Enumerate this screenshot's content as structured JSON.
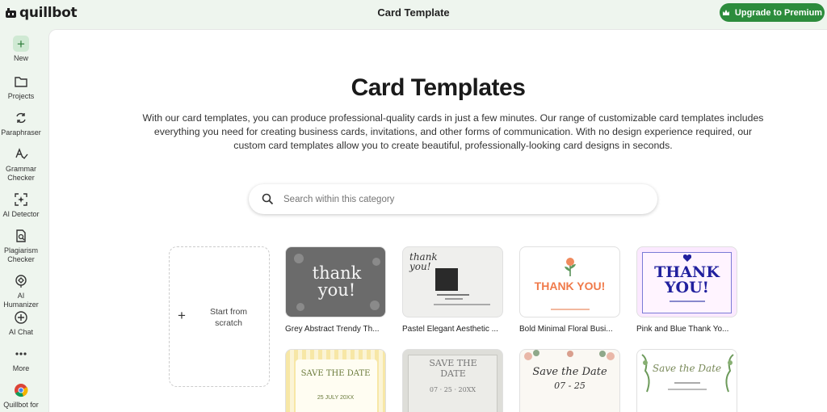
{
  "app": {
    "logo_text": "quillbot",
    "window_title": "Card Template",
    "upgrade_label": "Upgrade to Premium"
  },
  "sidebar": {
    "items": [
      {
        "label": "New"
      },
      {
        "label": "Projects"
      },
      {
        "label": "Paraphraser"
      },
      {
        "label": "Grammar Checker"
      },
      {
        "label": "AI Detector"
      },
      {
        "label": "Plagiarism Checker"
      },
      {
        "label": "AI Humanizer"
      },
      {
        "label": "AI Chat"
      },
      {
        "label": "More"
      },
      {
        "label": "Quillbot for"
      }
    ]
  },
  "main": {
    "heading": "Card Templates",
    "description": "With our card templates, you can produce professional-quality cards in just a few minutes. Our range of customizable card templates includes everything you need for creating business cards, invitations, and other forms of communication. With no design experience required, our custom card templates allow you to create beautiful, professionally-looking card designs in seconds.",
    "search_placeholder": "Search within this category",
    "scratch_label": "Start from scratch",
    "templates": [
      {
        "name": "Grey Abstract Trendy Th...",
        "art": "thank you!"
      },
      {
        "name": "Pastel Elegant Aesthetic ...",
        "art": "thank you!"
      },
      {
        "name": "Bold Minimal Floral Busi...",
        "art": "THANK YOU!"
      },
      {
        "name": "Pink and Blue Thank Yo...",
        "art": "THANK YOU!"
      }
    ],
    "templates_row2": [
      {
        "art": "SAVE THE DATE",
        "sub": "25 JULY 20XX"
      },
      {
        "art": "SAVE THE DATE",
        "sub": "07 · 25 · 20XX"
      },
      {
        "art": "Save the Date",
        "sub": "07 - 25"
      },
      {
        "art": "Save the Date"
      }
    ]
  }
}
